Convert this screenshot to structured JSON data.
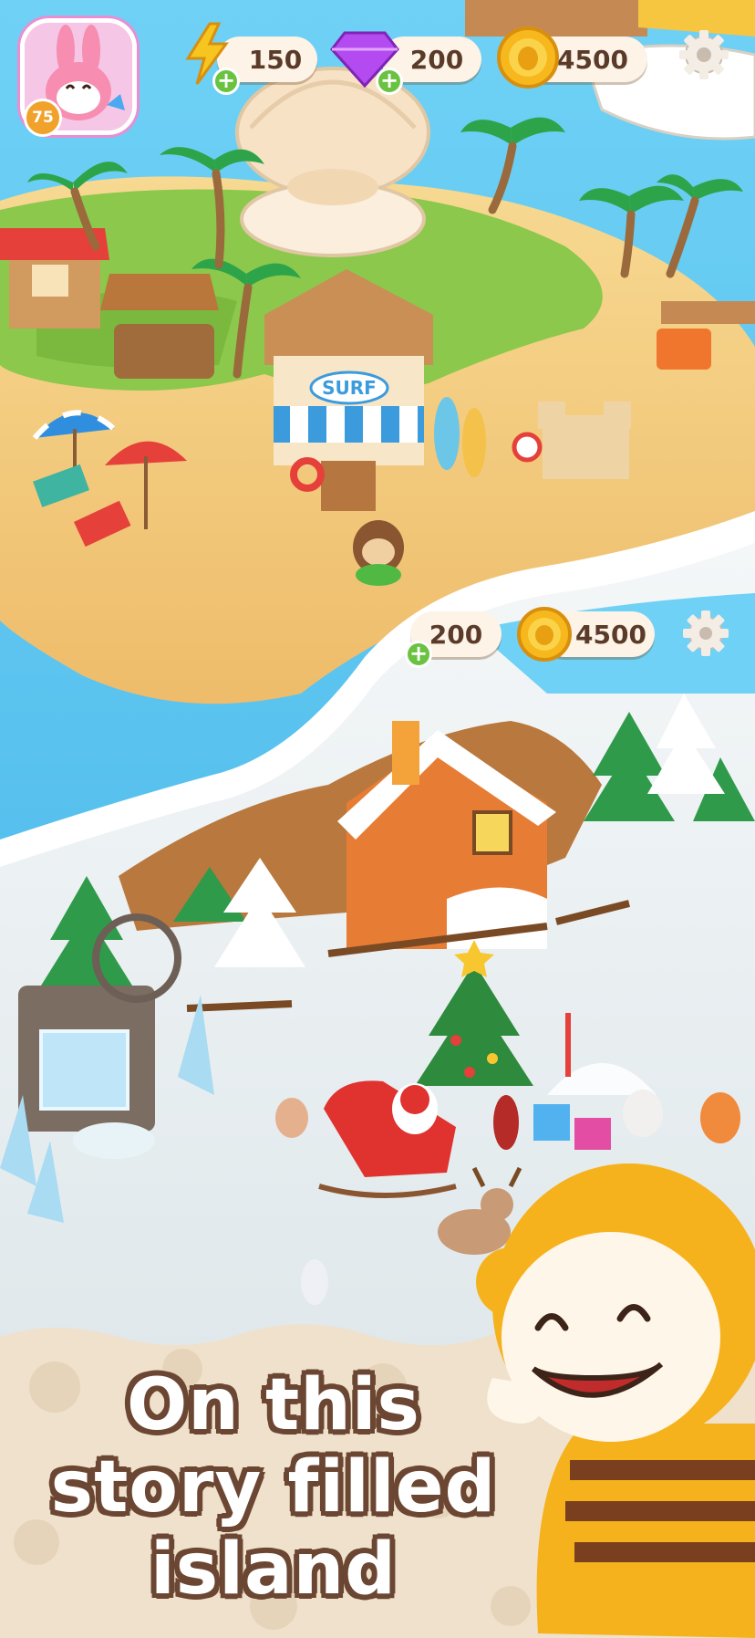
{
  "hud_top": {
    "energy": "150",
    "gems": "200",
    "coins": "4500",
    "level": "75"
  },
  "hud_lower": {
    "gems": "200",
    "coins": "4500"
  },
  "shop_sign": "SURF",
  "caption": {
    "line1": "On this",
    "line2": "story filled",
    "line3": "island"
  },
  "colors": {
    "ocean": "#58c4ee",
    "sand": "#f3cf86",
    "grass": "#8cc84b",
    "snow": "#e9eef0",
    "caption_bg": "#efe1cc",
    "caption_outline": "#6b4632",
    "coin": "#f6b81c",
    "gem": "#b34bf0",
    "energy": "#f7c51f",
    "plus": "#69c340"
  },
  "icons": [
    "bolt-icon",
    "gem-icon",
    "coin-icon",
    "gear-icon",
    "plus-icon",
    "avatar"
  ]
}
